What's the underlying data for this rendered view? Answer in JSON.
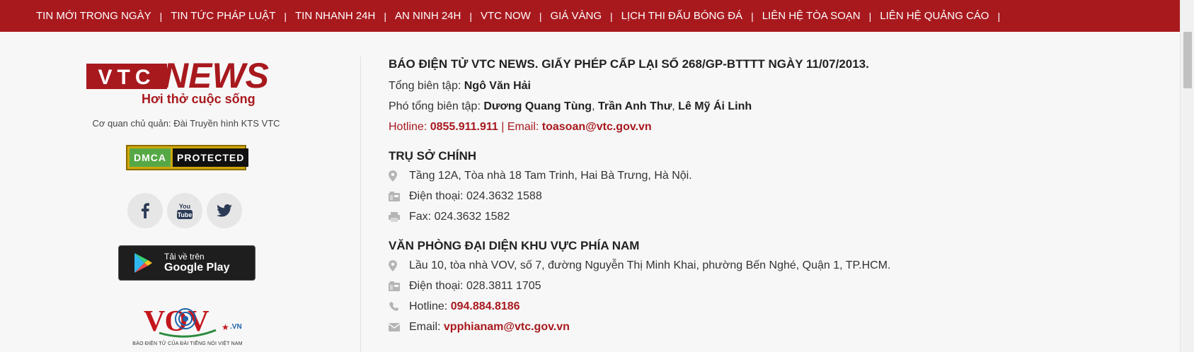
{
  "nav": {
    "items": [
      "TIN MỚI TRONG NGÀY",
      "TIN TỨC PHÁP LUẬT",
      "TIN NHANH 24H",
      "AN NINH 24H",
      "VTC NOW",
      "GIÁ VÀNG",
      "LỊCH THI ĐẤU BÓNG ĐÁ",
      "LIÊN HỆ TÒA SOẠN",
      "LIÊN HỆ QUẢNG CÁO"
    ],
    "separator": "|"
  },
  "left": {
    "logo": {
      "vtc": "VTC",
      "news": "NEWS",
      "slogan": "Hơi thở cuộc sống"
    },
    "owner": "Cơ quan chủ quản: Đài Truyền hình KTS VTC",
    "dmca": {
      "left": "DMCA",
      "right": "PROTECTED"
    },
    "social": [
      "facebook-icon",
      "youtube-icon",
      "twitter-icon"
    ],
    "gplay": {
      "line1": "Tải về trên",
      "line2": "Google Play"
    },
    "vov": {
      "logo": "VOV",
      "suffix": ".VN",
      "caption": "BÁO ĐIỆN TỬ CỦA ĐÀI TIẾNG NÓI VIỆT NAM"
    }
  },
  "info": {
    "license": "BÁO ĐIỆN TỬ VTC NEWS. GIẤY PHÉP CẤP LẠI SỐ 268/GP-BTTTT NGÀY 11/07/2013.",
    "editor_label": "Tổng biên tập:",
    "editor": "Ngô Văn Hải",
    "deputy_label": "Phó tổng biên tập:",
    "deputies": [
      "Dương Quang Tùng",
      "Trần Anh Thư",
      "Lê Mỹ Ái Linh"
    ],
    "hotline_label": "Hotline:",
    "hotline": "0855.911.911",
    "email_label": "| Email:",
    "email": "toasoan@vtc.gov.vn"
  },
  "hq": {
    "title": "TRỤ SỞ CHÍNH",
    "address": "Tầng 12A, Tòa nhà 18 Tam Trinh, Hai Bà Trưng, Hà Nội.",
    "phone": "Điện thoại: 024.3632 1588",
    "fax": "Fax: 024.3632 1582"
  },
  "south": {
    "title": "VĂN PHÒNG ĐẠI DIỆN KHU VỰC PHÍA NAM",
    "address": "Lầu 10, tòa nhà VOV, số 7, đường Nguyễn Thị Minh Khai, phường Bến Nghé, Quận 1, TP.HCM.",
    "phone": "Điện thoại: 028.3811 1705",
    "hotline_label": "Hotline:",
    "hotline": "094.884.8186",
    "email_label": "Email:",
    "email": "vpphianam@vtc.gov.vn"
  },
  "colors": {
    "brand_red": "#a8191e",
    "background": "#f7f7f7"
  }
}
